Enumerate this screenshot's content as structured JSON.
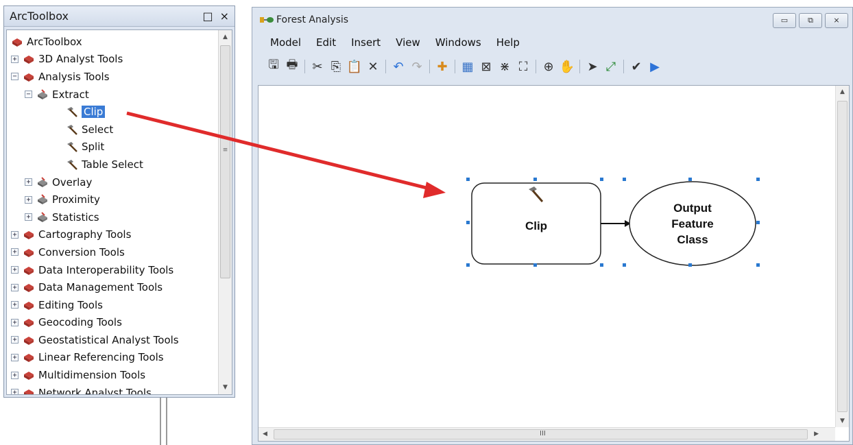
{
  "toolbox": {
    "title": "ArcToolbox",
    "controls": [
      "□",
      "×"
    ],
    "items": [
      {
        "label": "ArcToolbox",
        "level": 0,
        "expander": "",
        "icon": "toolbox-icon"
      },
      {
        "label": "3D Analyst Tools",
        "level": 0,
        "expander": "+",
        "icon": "toolbox-icon"
      },
      {
        "label": "Analysis Tools",
        "level": 0,
        "expander": "−",
        "icon": "toolbox-icon"
      },
      {
        "label": "Extract",
        "level": 1,
        "expander": "−",
        "icon": "toolset-icon"
      },
      {
        "label": "Clip",
        "level": 2,
        "expander": "",
        "icon": "hammer-icon",
        "selected": true
      },
      {
        "label": "Select",
        "level": 2,
        "expander": "",
        "icon": "hammer-icon"
      },
      {
        "label": "Split",
        "level": 2,
        "expander": "",
        "icon": "hammer-icon"
      },
      {
        "label": "Table Select",
        "level": 2,
        "expander": "",
        "icon": "hammer-icon"
      },
      {
        "label": "Overlay",
        "level": 1,
        "expander": "+",
        "icon": "toolset-icon"
      },
      {
        "label": "Proximity",
        "level": 1,
        "expander": "+",
        "icon": "toolset-icon"
      },
      {
        "label": "Statistics",
        "level": 1,
        "expander": "+",
        "icon": "toolset-icon"
      },
      {
        "label": "Cartography Tools",
        "level": 0,
        "expander": "+",
        "icon": "toolbox-icon"
      },
      {
        "label": "Conversion Tools",
        "level": 0,
        "expander": "+",
        "icon": "toolbox-icon"
      },
      {
        "label": "Data Interoperability Tools",
        "level": 0,
        "expander": "+",
        "icon": "toolbox-icon"
      },
      {
        "label": "Data Management Tools",
        "level": 0,
        "expander": "+",
        "icon": "toolbox-icon"
      },
      {
        "label": "Editing Tools",
        "level": 0,
        "expander": "+",
        "icon": "toolbox-icon"
      },
      {
        "label": "Geocoding Tools",
        "level": 0,
        "expander": "+",
        "icon": "toolbox-icon"
      },
      {
        "label": "Geostatistical Analyst Tools",
        "level": 0,
        "expander": "+",
        "icon": "toolbox-icon"
      },
      {
        "label": "Linear Referencing Tools",
        "level": 0,
        "expander": "+",
        "icon": "toolbox-icon"
      },
      {
        "label": "Multidimension Tools",
        "level": 0,
        "expander": "+",
        "icon": "toolbox-icon"
      },
      {
        "label": "Network Analyst Tools",
        "level": 0,
        "expander": "+",
        "icon": "toolbox-icon"
      }
    ]
  },
  "model_window": {
    "title": "Forest Analysis",
    "window_controls": [
      "▭",
      "⧉",
      "⨯"
    ],
    "menu": [
      "Model",
      "Edit",
      "Insert",
      "View",
      "Windows",
      "Help"
    ],
    "toolbar": [
      {
        "icon": "save-icon",
        "glyph": "🖫"
      },
      {
        "icon": "print-icon",
        "glyph": "🖶"
      },
      {
        "sep": true
      },
      {
        "icon": "cut-icon",
        "glyph": "✂"
      },
      {
        "icon": "copy-icon",
        "glyph": "⎘"
      },
      {
        "icon": "paste-icon",
        "glyph": "📋"
      },
      {
        "icon": "delete-icon",
        "glyph": "✕"
      },
      {
        "sep": true
      },
      {
        "icon": "undo-icon",
        "glyph": "↶"
      },
      {
        "icon": "redo-icon",
        "glyph": "↷"
      },
      {
        "sep": true
      },
      {
        "icon": "add-data-icon",
        "glyph": "✚"
      },
      {
        "sep": true
      },
      {
        "icon": "auto-layout-icon",
        "glyph": "▦"
      },
      {
        "icon": "full-extent-icon",
        "glyph": "⊠"
      },
      {
        "icon": "fixed-zoom-in-icon",
        "glyph": "⋇"
      },
      {
        "icon": "fixed-zoom-out-icon",
        "glyph": "⛶"
      },
      {
        "sep": true
      },
      {
        "icon": "zoom-in-icon",
        "glyph": "⊕"
      },
      {
        "icon": "pan-icon",
        "glyph": "✋"
      },
      {
        "sep": true
      },
      {
        "icon": "select-icon",
        "glyph": "➤"
      },
      {
        "icon": "connect-icon",
        "glyph": "⤢"
      },
      {
        "sep": true
      },
      {
        "icon": "validate-icon",
        "glyph": "✔"
      },
      {
        "icon": "run-icon",
        "glyph": "▶"
      }
    ],
    "diagram": {
      "tool_node": {
        "label": "Clip",
        "icon": "hammer-icon"
      },
      "output_node": {
        "lines": [
          "Output",
          "Feature",
          "Class"
        ]
      }
    },
    "scroll_grip": "III"
  },
  "annotation": {
    "arrow_color": "#e02b2b",
    "description_free": true
  },
  "colors": {
    "selection": "#3a7bd5",
    "handles": "#2a79d0",
    "panel_bg": "#dde5f1"
  }
}
